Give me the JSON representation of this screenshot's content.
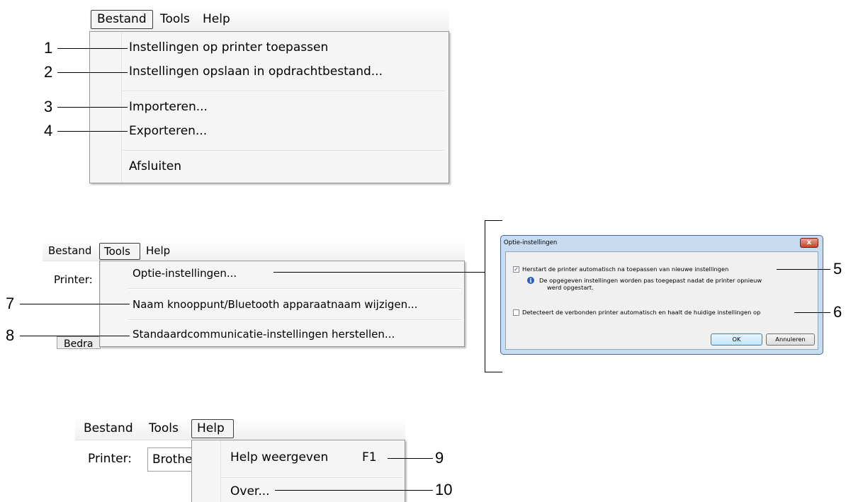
{
  "panel1": {
    "menubar": [
      "Bestand",
      "Tools",
      "Help"
    ],
    "items": [
      "Instellingen op printer toepassen",
      "Instellingen opslaan in opdrachtbestand...",
      "Importeren...",
      "Exporteren...",
      "Afsluiten"
    ],
    "callouts": [
      "1",
      "2",
      "3",
      "4"
    ]
  },
  "panel2": {
    "menubar": [
      "Bestand",
      "Tools",
      "Help"
    ],
    "printer_label": "Printer:",
    "under_text": "Bedra",
    "items": [
      "Optie-instellingen...",
      "Naam knooppunt/Bluetooth apparaatnaam wijzigen...",
      "Standaardcommunicatie-instellingen herstellen..."
    ],
    "callouts": [
      "7",
      "8"
    ]
  },
  "dialog": {
    "title": "Optie-instellingen",
    "close": "x",
    "option1": "Herstart de printer automatisch na toepassen van nieuwe instellingen",
    "option1_checked": true,
    "note_line1": "De opgegeven instellingen worden pas toegepast nadat de printer opnieuw",
    "note_line2": "werd opgestart.",
    "option2": "Detecteert de verbonden printer automatisch en haalt de huidige instellingen op",
    "option2_checked": false,
    "ok": "OK",
    "cancel": "Annuleren",
    "callouts": [
      "5",
      "6"
    ]
  },
  "panel3": {
    "menubar": [
      "Bestand",
      "Tools",
      "Help"
    ],
    "printer_label": "Printer:",
    "printer_value": "Brothe",
    "items": [
      "Help weergeven",
      "Over..."
    ],
    "shortcut": "F1",
    "callouts": [
      "9",
      "10"
    ]
  },
  "colors": {
    "menu_bg": "#f5f5f5",
    "dialog_frame": "#c7dbf1",
    "close_button": "#c7452b"
  }
}
